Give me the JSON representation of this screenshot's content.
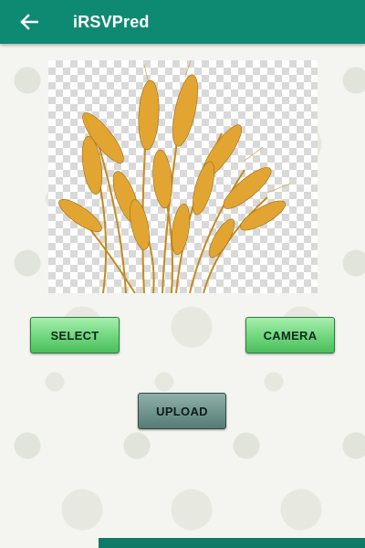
{
  "appbar": {
    "title": "iRSVPred",
    "back_icon": "arrow-left-icon",
    "color": "#0f8a72"
  },
  "preview": {
    "image_description_icon": "wheat-image"
  },
  "buttons": {
    "select_label": "SELECT",
    "camera_label": "CAMERA",
    "upload_label": "UPLOAD"
  },
  "colors": {
    "green_button": "#6fd57c",
    "gray_button": "#6c918a",
    "bottom_bar": "#0f7a66"
  }
}
